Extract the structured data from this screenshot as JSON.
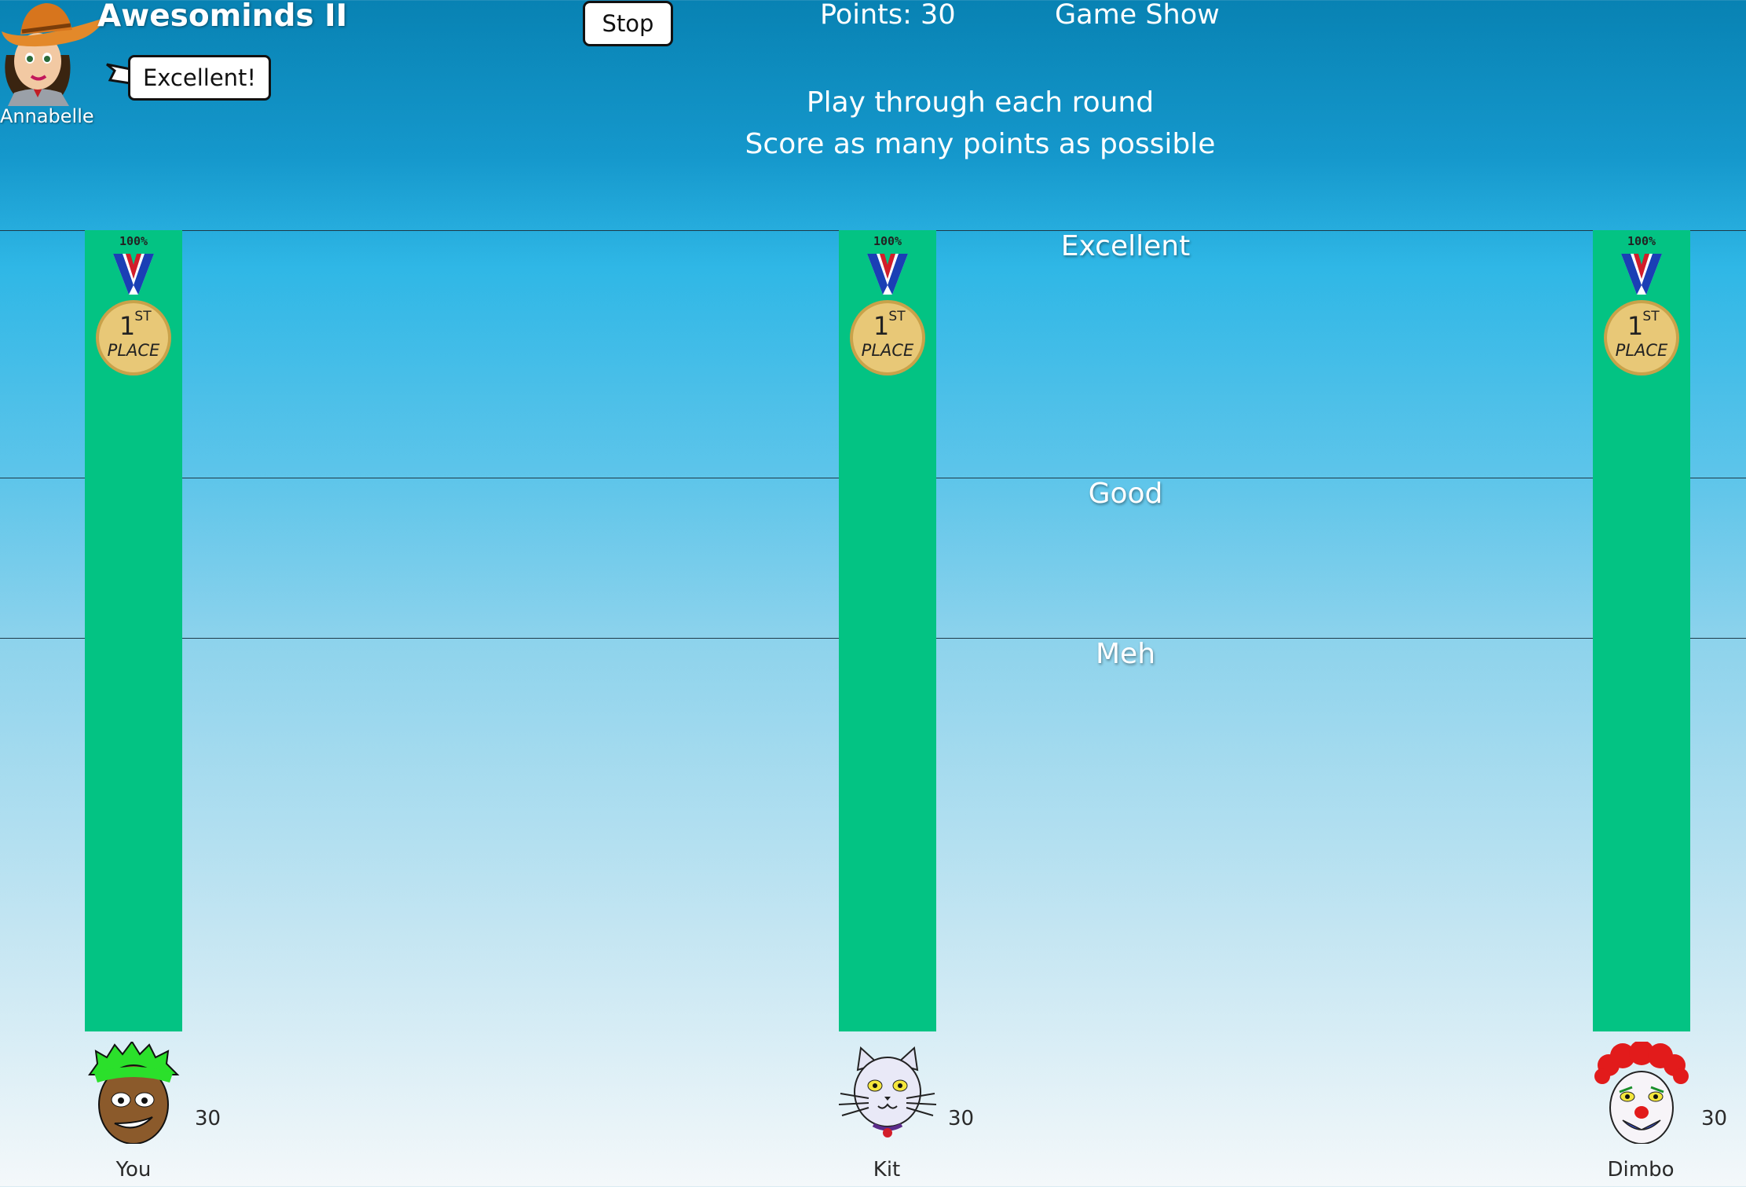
{
  "app_title": "Awesominds II",
  "host": {
    "name": "Annabelle",
    "speech": "Excellent!"
  },
  "stop_label": "Stop",
  "points_text": "Points: 30",
  "mode_text": "Game Show",
  "instructions": [
    "Play through each round",
    "Score as many points as possible"
  ],
  "zones": [
    "Excellent",
    "Good",
    "Meh"
  ],
  "colors": {
    "bar": "#03c383",
    "text": "#ffffff"
  },
  "players": [
    {
      "name": "You",
      "score": "30",
      "progress": 1.0,
      "medal_pct": "100%",
      "medal_line1": "1",
      "medal_sup": "ST",
      "medal_line2": "PLACE",
      "avatar": "green-hair-boy-icon"
    },
    {
      "name": "Kit",
      "score": "30",
      "progress": 1.0,
      "medal_pct": "100%",
      "medal_line1": "1",
      "medal_sup": "ST",
      "medal_line2": "PLACE",
      "avatar": "cat-icon"
    },
    {
      "name": "Dimbo",
      "score": "30",
      "progress": 1.0,
      "medal_pct": "100%",
      "medal_line1": "1",
      "medal_sup": "ST",
      "medal_line2": "PLACE",
      "avatar": "clown-icon"
    }
  ]
}
